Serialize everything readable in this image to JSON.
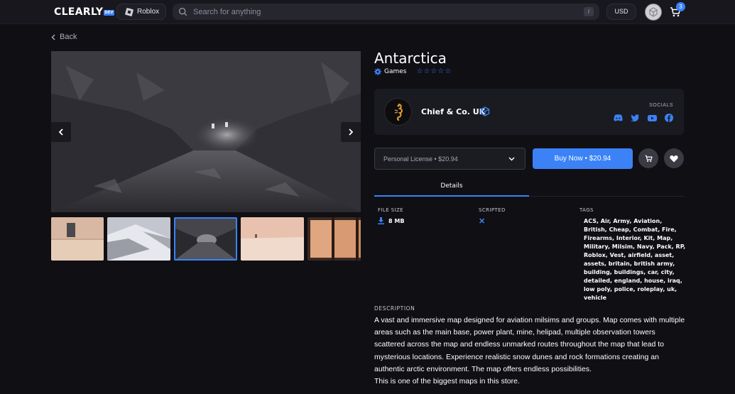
{
  "header": {
    "logo": "CLEARLY",
    "logo_sub": "DEV",
    "platform": "Roblox",
    "search_placeholder": "Search for anything",
    "search_shortcut": "/",
    "currency": "USD",
    "cart_count": "3"
  },
  "nav": {
    "back_label": "Back"
  },
  "product": {
    "title": "Antarctica",
    "category": "Games",
    "rating_stars": "☆☆☆☆☆",
    "seller": {
      "name": "Chief & Co. UK",
      "socials_label": "SOCIALS",
      "socials": [
        "discord-icon",
        "twitter-icon",
        "youtube-icon",
        "facebook-icon"
      ]
    },
    "license_option": "Personal License • $20.94",
    "buy_label": "Buy Now • $20.94",
    "tabs": [
      "Details"
    ],
    "details": {
      "file_size_label": "FILE SIZE",
      "file_size": "8 MB",
      "scripted_label": "SCRIPTED",
      "scripted_value": "✕",
      "tags_label": "TAGS",
      "tags": "ACS, Air, Army, Aviation, British, Cheap, Combat, Fire, Firearms, Interior, Kit, Map, Military, Milsim, Navy, Pack, RP, Roblox, Vest, airfield, asset, assets, britain, british army, building, buildings, car, city, detailed, england, house, iraq, low poly, police, roleplay, uk, vehicle"
    },
    "description_label": "DESCRIPTION",
    "description": [
      "A vast and immersive map designed for aviation milsims and groups. Map comes with multiple areas such as the main base, power plant, mine, helipad, multiple observation towers scattered across the map and endless unmarked routes throughout the map that lead to mysterious locations. Experience realistic snow dunes and rock formations creating an authentic arctic environment. The map offers endless possibilities.",
      "This is one of the biggest maps in this store."
    ]
  },
  "colors": {
    "accent": "#3b82f6",
    "background": "#0f0f14",
    "card": "#1a1a21"
  }
}
